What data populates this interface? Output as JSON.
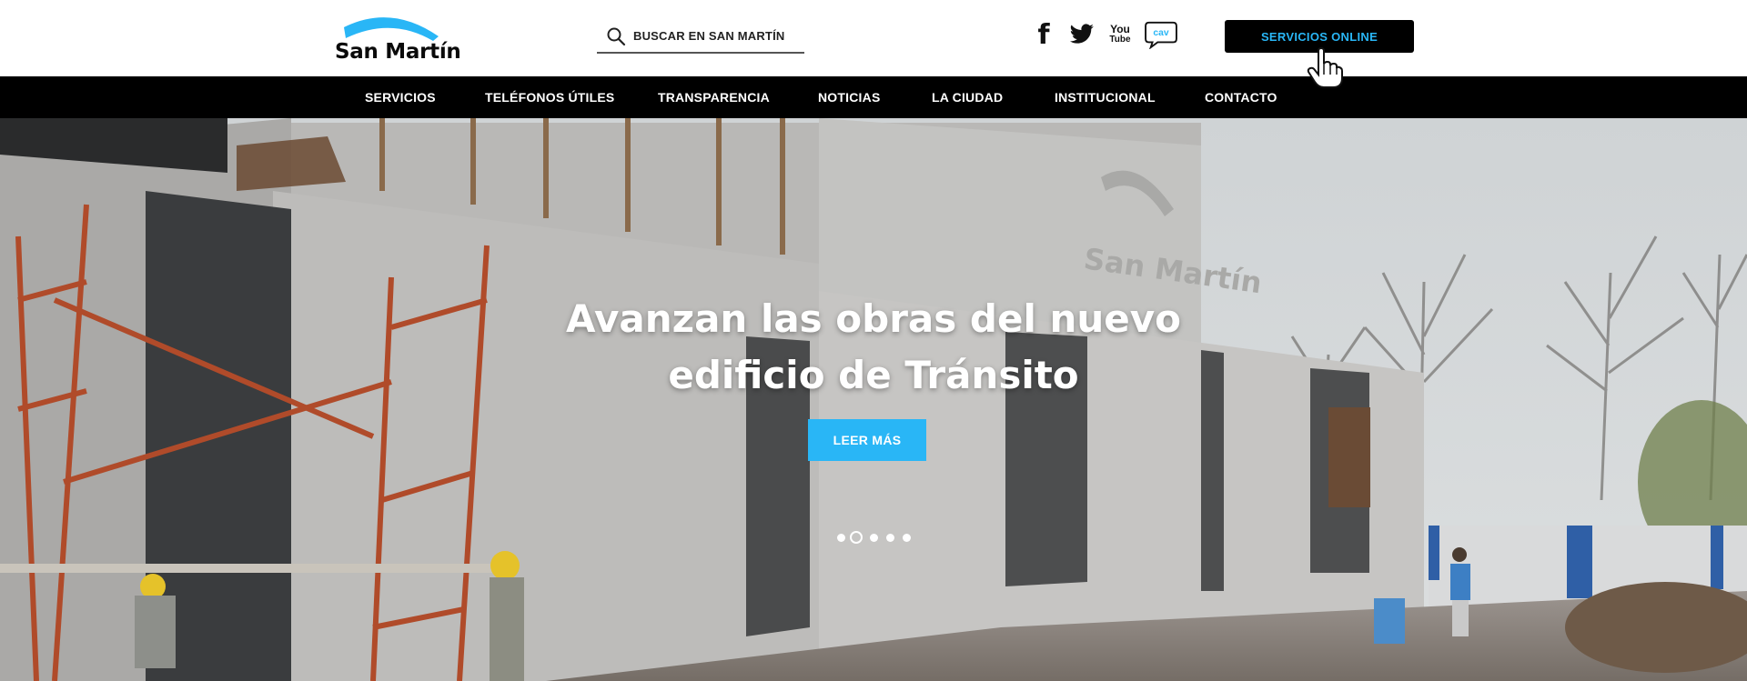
{
  "header": {
    "logo_text": "San Martín",
    "search_placeholder": "BUSCAR EN SAN MARTÍN",
    "social": {
      "facebook": "f",
      "youtube_top": "You",
      "youtube_bottom": "Tube",
      "cav": "cav"
    },
    "cta_label": "SERVICIOS ONLINE"
  },
  "nav": {
    "items": [
      "SERVICIOS",
      "TELÉFONOS ÚTILES",
      "TRANSPARENCIA",
      "NOTICIAS",
      "LA CIUDAD",
      "INSTITUCIONAL",
      "CONTACTO"
    ]
  },
  "hero": {
    "title_line1": "Avanzan las obras del nuevo",
    "title_line2": "edificio de Tránsito",
    "button_label": "LEER MÁS",
    "building_sign": "San Martín",
    "slides_total": 5,
    "slide_active": 2
  },
  "colors": {
    "accent": "#29b6f6",
    "nav_bg": "#000000",
    "text": "#111111"
  },
  "icons": [
    "logo-arc-icon",
    "search-icon",
    "facebook-icon",
    "twitter-icon",
    "youtube-icon",
    "cav-icon",
    "hand-cursor-icon"
  ]
}
